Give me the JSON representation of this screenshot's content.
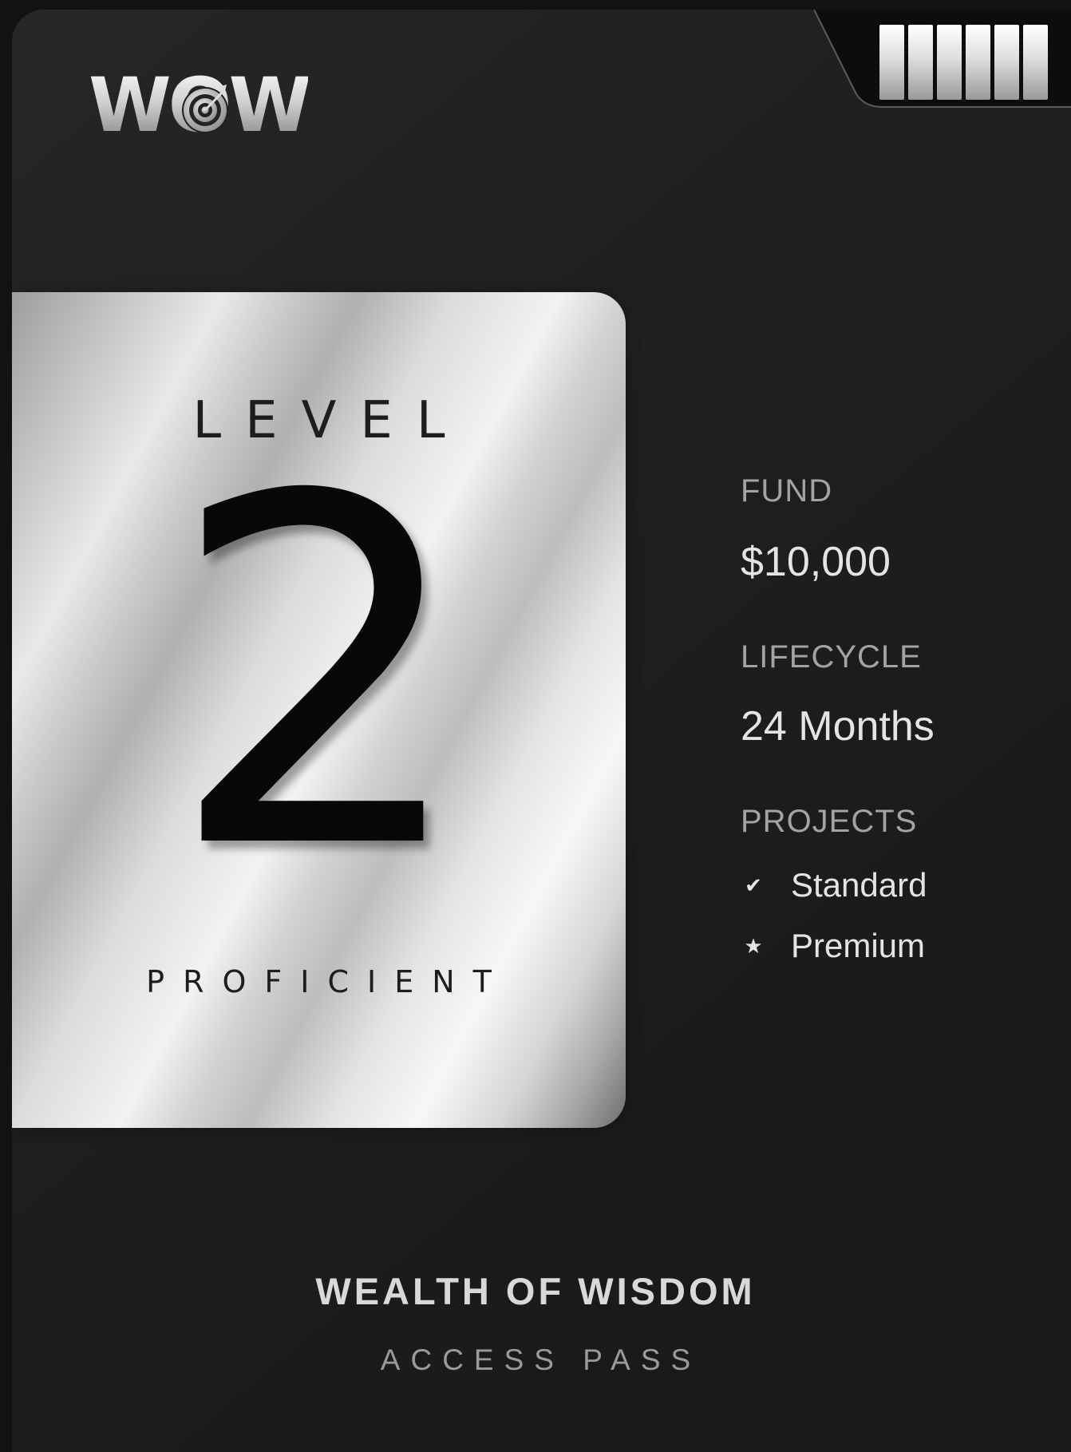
{
  "brand": {
    "logo_text": "WOW",
    "logo_icon": "target-icon",
    "signal_bars": 6
  },
  "level": {
    "label": "LEVEL",
    "number": "2",
    "rank": "PROFICIENT"
  },
  "details": {
    "fund_label": "FUND",
    "fund_value": "$10,000",
    "lifecycle_label": "LIFECYCLE",
    "lifecycle_value": "24 Months",
    "projects_label": "PROJECTS",
    "projects": [
      {
        "icon": "check-icon",
        "glyph": "✔",
        "label": "Standard"
      },
      {
        "icon": "star-icon",
        "glyph": "★",
        "label": "Premium"
      }
    ]
  },
  "footer": {
    "title": "WEALTH OF WISDOM",
    "subtitle": "ACCESS PASS"
  },
  "colors": {
    "background": "#121212",
    "card": "#1f1f1f",
    "silver": "#d8d8d8",
    "label_gray": "#a3a3a3",
    "value_white": "#e4e4e4"
  }
}
